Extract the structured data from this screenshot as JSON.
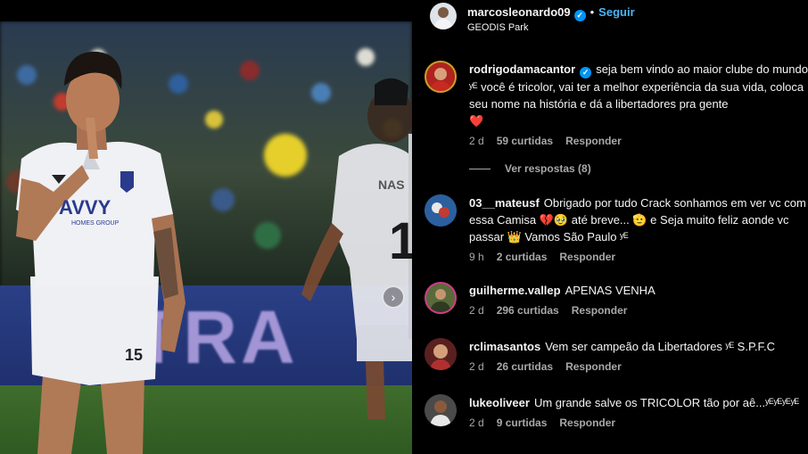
{
  "photo": {
    "banner_text": "TRA",
    "shirt_sponsor": "AVVY",
    "shirt_sponsor_sub": "HOMES GROUP",
    "back_number": "1",
    "back_name": "NAS",
    "shorts_number": "15",
    "carousel_next_icon": "chevron-right-icon"
  },
  "post": {
    "author": "marcosleonardo09",
    "verified_icon": "verified-badge-icon",
    "separator": "•",
    "follow_label": "Seguir",
    "location": "GEODIS Park"
  },
  "comments": [
    {
      "username": "rodrigodamacantor",
      "verified": true,
      "text": "seja bem vindo ao maior clube do mundo ʸᴱ você é tricolor, vai ter a melhor experiência da sua vida, coloca seu nome na história e dá a libertadores pra gente",
      "trailing_emoji": "❤️",
      "time": "2 d",
      "likes": "59 curtidas",
      "reply_label": "Responder",
      "avatar_color": "#b0231f"
    },
    {
      "username": "03__mateusf",
      "verified": false,
      "text": "Obrigado por tudo Crack sonhamos em ver vc com essa Camisa 💔🥹 até breve... 🫡 e Seja muito feliz aonde vc passar 👑 Vamos São Paulo ʸᴱ",
      "trailing_emoji": "",
      "time": "9 h",
      "likes": "2 curtidas",
      "reply_label": "Responder",
      "avatar_color": "#3a6fb0"
    },
    {
      "username": "guilherme.vallep",
      "verified": false,
      "text": "APENAS VENHA",
      "trailing_emoji": "",
      "time": "2 d",
      "likes": "296 curtidas",
      "reply_label": "Responder",
      "avatar_color": "#5a6a3a"
    },
    {
      "username": "rclimasantos",
      "verified": false,
      "text": "Vem ser campeão da Libertadores ʸᴱ S.P.F.C",
      "trailing_emoji": "",
      "time": "2 d",
      "likes": "26 curtidas",
      "reply_label": "Responder",
      "avatar_color": "#7a2a2a"
    },
    {
      "username": "lukeoliveer",
      "verified": false,
      "text": "Um grande salve os TRICOLOR tão por aê...ʸᴱʸᴱʸᴱʸᴱ",
      "trailing_emoji": "",
      "time": "2 d",
      "likes": "9 curtidas",
      "reply_label": "Responder",
      "avatar_color": "#3b3b3b"
    }
  ],
  "view_replies_label": "Ver respostas (8)",
  "colors": {
    "background": "#000000",
    "text": "#f5f5f5",
    "meta": "#a8a8a8",
    "link": "#4cb5f9",
    "verified": "#0095f6",
    "heart": "#ff3f6c"
  }
}
